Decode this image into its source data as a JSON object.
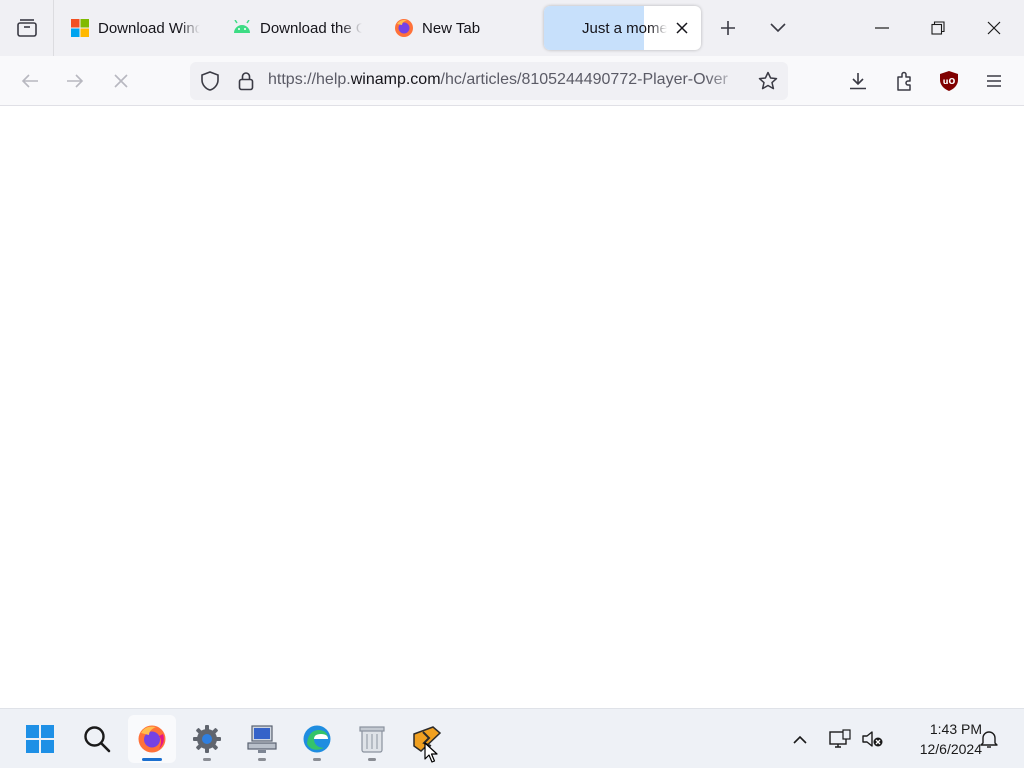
{
  "browser": {
    "tabs": [
      {
        "title": "Download Windows",
        "icon": "microsoft-logo-icon",
        "active": false
      },
      {
        "title": "Download the Google",
        "icon": "android-icon",
        "active": false
      },
      {
        "title": "New Tab",
        "icon": "firefox-icon",
        "active": false
      },
      {
        "title": "Just a moment...",
        "icon": "loading-icon",
        "active": true
      }
    ],
    "url": {
      "scheme": "https://help.",
      "host": "winamp.com",
      "path": "/hc/articles/8105244490772-Player-Over"
    },
    "toolbar_icons": [
      "back-icon",
      "forward-icon",
      "stop-icon",
      "tracking-shield-icon",
      "lock-icon",
      "bookmark-star-icon",
      "download-icon",
      "extensions-icon",
      "ublock-origin-icon",
      "menu-icon"
    ],
    "colors": {
      "tab_loading": "#c7e0fb",
      "ublock": "#800000"
    }
  },
  "taskbar": {
    "apps": [
      "windows-start-icon",
      "search-icon",
      "firefox-icon",
      "settings-icon",
      "network-computer-icon",
      "edge-icon",
      "recycle-bin-icon",
      "winamp-icon"
    ],
    "tray_icons": [
      "chevron-up-icon",
      "network-icon",
      "volume-muted-icon",
      "notification-bell-icon"
    ],
    "time": "1:43 PM",
    "date": "12/6/2024"
  }
}
